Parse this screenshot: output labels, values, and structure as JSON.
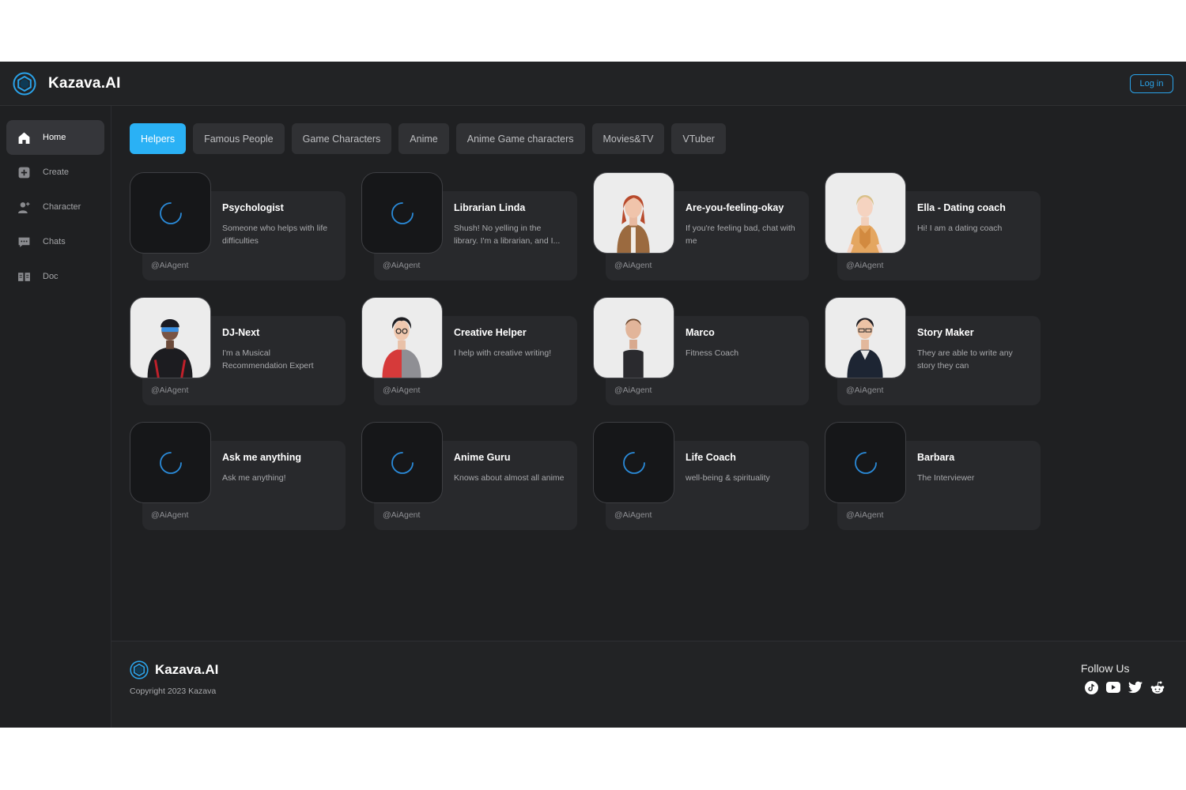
{
  "header": {
    "brand": "Kazava.AI",
    "login_label": "Log in"
  },
  "sidebar": {
    "items": [
      {
        "label": "Home",
        "icon": "home-icon"
      },
      {
        "label": "Create",
        "icon": "plus-square-icon"
      },
      {
        "label": "Character",
        "icon": "person-add-icon"
      },
      {
        "label": "Chats",
        "icon": "chat-bubble-icon"
      },
      {
        "label": "Doc",
        "icon": "book-icon"
      }
    ]
  },
  "tabs": [
    {
      "label": "Helpers"
    },
    {
      "label": "Famous People"
    },
    {
      "label": "Game Characters"
    },
    {
      "label": "Anime"
    },
    {
      "label": "Anime Game characters"
    },
    {
      "label": "Movies&TV"
    },
    {
      "label": "VTuber"
    }
  ],
  "cards": [
    {
      "title": "Psychologist",
      "desc": "Someone who helps with life difficulties",
      "handle": "@AiAgent"
    },
    {
      "title": "Librarian Linda",
      "desc": "Shush! No yelling in the library. I'm a librarian, and I...",
      "handle": "@AiAgent"
    },
    {
      "title": "Are-you-feeling-okay",
      "desc": "If you're feeling bad, chat with me",
      "handle": "@AiAgent"
    },
    {
      "title": "Ella - Dating coach",
      "desc": "Hi! I am a dating coach",
      "handle": "@AiAgent"
    },
    {
      "title": "DJ-Next",
      "desc": "I'm a Musical Recommendation Expert",
      "handle": "@AiAgent"
    },
    {
      "title": "Creative Helper",
      "desc": "I help with creative writing!",
      "handle": "@AiAgent"
    },
    {
      "title": "Marco",
      "desc": "Fitness Coach",
      "handle": "@AiAgent"
    },
    {
      "title": "Story Maker",
      "desc": "They are able to write any story they can",
      "handle": "@AiAgent"
    },
    {
      "title": "Ask me anything",
      "desc": "Ask me anything!",
      "handle": "@AiAgent"
    },
    {
      "title": "Anime Guru",
      "desc": "Knows about almost all anime",
      "handle": "@AiAgent"
    },
    {
      "title": "Life Coach",
      "desc": "well-being & spirituality",
      "handle": "@AiAgent"
    },
    {
      "title": "Barbara",
      "desc": "The Interviewer",
      "handle": "@AiAgent"
    }
  ],
  "footer": {
    "brand": "Kazava.AI",
    "copyright": "Copyright 2023 Kazava",
    "follow_label": "Follow Us",
    "socials": [
      "tiktok-icon",
      "youtube-icon",
      "twitter-icon",
      "reddit-icon"
    ]
  },
  "colors": {
    "accent": "#2ab1f5",
    "background": "#1f2022",
    "card": "#28292c"
  }
}
